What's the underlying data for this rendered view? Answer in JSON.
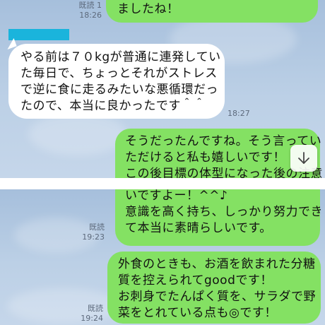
{
  "top_panel": {
    "msg_sent_1": {
      "lines": [
        "ましたね！"
      ],
      "read": "既読 1",
      "time": "18:26"
    },
    "msg_received": {
      "lines": [
        "やる前は７０kgが普通に連発してい",
        "た毎日で、ちょっとそれがストレス",
        "で逆に食に走るみたいな悪循環だっ",
        "たので、本当に良かったです＾＾"
      ],
      "time": "18:27"
    },
    "msg_sent_2": {
      "lines": [
        "そうだったんですね。そう言ってい",
        "ただけると私も嬉しいです！",
        "この後目標の体型になった後の注意"
      ]
    },
    "scroll_icon": "arrow-down-icon"
  },
  "bottom_panel": {
    "msg_sent_3": {
      "lines": [
        "いですよー！^^♪",
        "意識を高く持ち、しっかり努力でき",
        "て本当に素晴らしいです。"
      ],
      "read": "既読",
      "time": "19:23"
    },
    "msg_sent_4": {
      "lines": [
        "外食のときも、お酒を飲まれた分糖",
        "質を控えられてgoodです！",
        "お刺身でたんぱく質を、サラダで野",
        "菜をとれている点も◎です！"
      ],
      "read": "既読",
      "time": "19:24"
    }
  },
  "colors": {
    "sent_bubble": "#84e163",
    "received_bubble": "#ffffff",
    "name_bar": "#1ab4dc",
    "background": "#b4c9e2"
  }
}
